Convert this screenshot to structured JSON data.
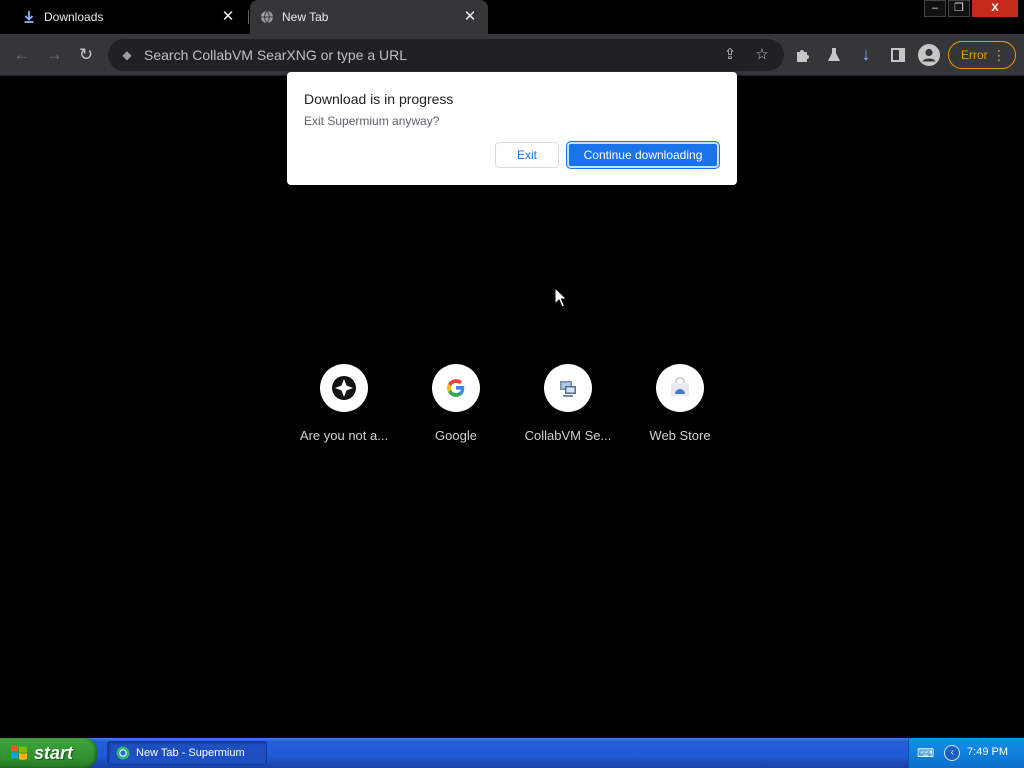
{
  "tabs": [
    {
      "label": "Downloads",
      "icon": "download-icon",
      "active": false
    },
    {
      "label": "New Tab",
      "icon": "globe-icon",
      "active": true
    }
  ],
  "window_controls": {
    "minimize": "–",
    "restore": "❐",
    "close": "X"
  },
  "toolbar": {
    "omnibox_placeholder": "Search CollabVM SearXNG or type a URL",
    "error_label": "Error",
    "error_color": "#f29900"
  },
  "dialog": {
    "title": "Download is in progress",
    "message": "Exit Supermium anyway?",
    "exit_label": "Exit",
    "continue_label": "Continue downloading"
  },
  "shortcuts": [
    {
      "label": "Are you not a...",
      "icon": "compass-icon"
    },
    {
      "label": "Google",
      "icon": "google-icon"
    },
    {
      "label": "CollabVM Se...",
      "icon": "collabvm-icon"
    },
    {
      "label": "Web Store",
      "icon": "web-store-icon"
    }
  ],
  "taskbar": {
    "start_label": "start",
    "task_item_label": "New Tab - Supermium",
    "clock": "7:49 PM"
  },
  "colors": {
    "accent": "#1a73e8",
    "toolbar_bg": "#35363a",
    "page_bg": "#000000"
  }
}
